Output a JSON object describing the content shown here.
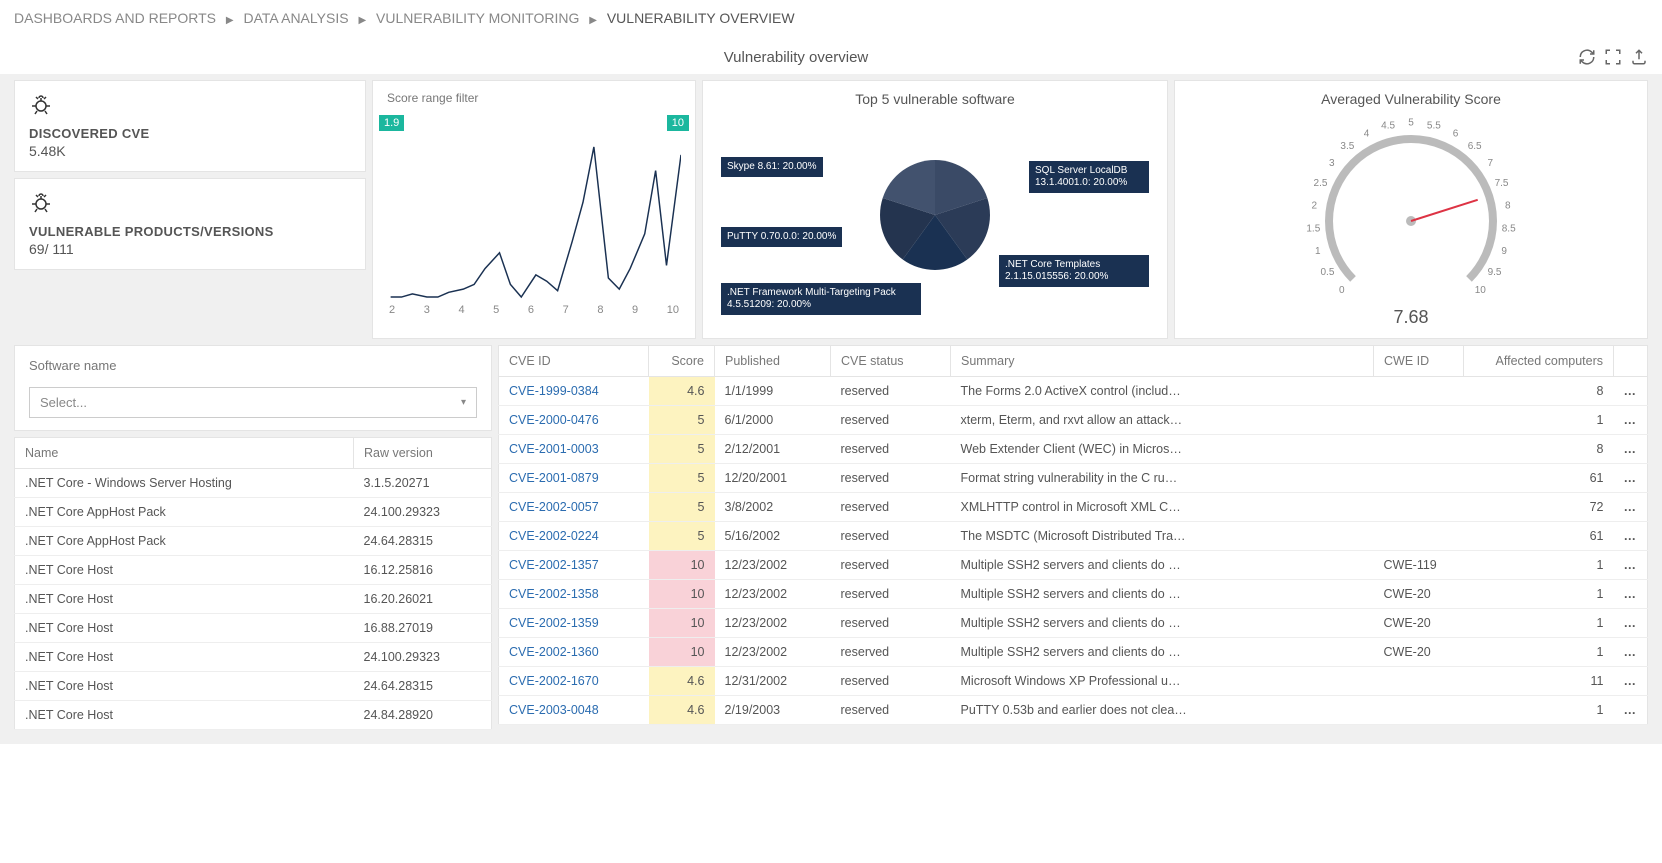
{
  "breadcrumb": {
    "items": [
      "DASHBOARDS AND REPORTS",
      "DATA ANALYSIS",
      "VULNERABILITY MONITORING"
    ],
    "current": "VULNERABILITY OVERVIEW"
  },
  "page_title": "Vulnerability overview",
  "stats": {
    "discovered_cve": {
      "label": "DISCOVERED CVE",
      "value": "5.48K"
    },
    "vulnerable_versions": {
      "label": "VULNERABLE PRODUCTS/VERSIONS",
      "value": "69/ 111"
    }
  },
  "score_filter": {
    "title": "Score range filter",
    "min": "1.9",
    "max": "10",
    "ticks": [
      "2",
      "3",
      "4",
      "5",
      "6",
      "7",
      "8",
      "9",
      "10"
    ]
  },
  "top5": {
    "title": "Top 5 vulnerable software",
    "slices": [
      {
        "label": "Skype 8.61: 20.00%",
        "value": 20
      },
      {
        "label": "SQL Server LocalDB 13.1.4001.0: 20.00%",
        "value": 20
      },
      {
        "label": "PuTTY 0.70.0.0: 20.00%",
        "value": 20
      },
      {
        "label": ".NET Core Templates 2.1.15.015556: 20.00%",
        "value": 20
      },
      {
        "label": ".NET Framework Multi-Targeting Pack 4.5.51209: 20.00%",
        "value": 20
      }
    ]
  },
  "gauge": {
    "title": "Averaged Vulnerability Score",
    "value": "7.68",
    "min": 0,
    "max": 10,
    "ticks": [
      "0",
      "0.5",
      "1",
      "1.5",
      "2",
      "2.5",
      "3",
      "3.5",
      "4",
      "4.5",
      "5",
      "5.5",
      "6",
      "6.5",
      "7",
      "7.5",
      "8",
      "8.5",
      "9",
      "9.5",
      "10"
    ]
  },
  "filter": {
    "label": "Software name",
    "placeholder": "Select..."
  },
  "sw_table": {
    "headers": [
      "Name",
      "Raw version"
    ],
    "rows": [
      {
        "name": ".NET Core - Windows Server Hosting",
        "ver": "3.1.5.20271"
      },
      {
        "name": ".NET Core AppHost Pack",
        "ver": "24.100.29323"
      },
      {
        "name": ".NET Core AppHost Pack",
        "ver": "24.64.28315"
      },
      {
        "name": ".NET Core Host",
        "ver": "16.12.25816"
      },
      {
        "name": ".NET Core Host",
        "ver": "16.20.26021"
      },
      {
        "name": ".NET Core Host",
        "ver": "16.88.27019"
      },
      {
        "name": ".NET Core Host",
        "ver": "24.100.29323"
      },
      {
        "name": ".NET Core Host",
        "ver": "24.64.28315"
      },
      {
        "name": ".NET Core Host",
        "ver": "24.84.28920"
      }
    ]
  },
  "cve_table": {
    "headers": [
      "CVE ID",
      "Score",
      "Published",
      "CVE status",
      "Summary",
      "CWE ID",
      "Affected computers",
      ""
    ],
    "rows": [
      {
        "id": "CVE-1999-0384",
        "score": 4.6,
        "pub": "1/1/1999",
        "status": "reserved",
        "summary": "The Forms 2.0 ActiveX control (includ…",
        "cwe": "",
        "aff": 8
      },
      {
        "id": "CVE-2000-0476",
        "score": 5,
        "pub": "6/1/2000",
        "status": "reserved",
        "summary": "xterm, Eterm, and rxvt allow an attack…",
        "cwe": "",
        "aff": 1
      },
      {
        "id": "CVE-2001-0003",
        "score": 5,
        "pub": "2/12/2001",
        "status": "reserved",
        "summary": "Web Extender Client (WEC) in Micros…",
        "cwe": "",
        "aff": 8
      },
      {
        "id": "CVE-2001-0879",
        "score": 5,
        "pub": "12/20/2001",
        "status": "reserved",
        "summary": "Format string vulnerability in the C ru…",
        "cwe": "",
        "aff": 61
      },
      {
        "id": "CVE-2002-0057",
        "score": 5,
        "pub": "3/8/2002",
        "status": "reserved",
        "summary": "XMLHTTP control in Microsoft XML C…",
        "cwe": "",
        "aff": 72
      },
      {
        "id": "CVE-2002-0224",
        "score": 5,
        "pub": "5/16/2002",
        "status": "reserved",
        "summary": "The MSDTC (Microsoft Distributed Tra…",
        "cwe": "",
        "aff": 61
      },
      {
        "id": "CVE-2002-1357",
        "score": 10,
        "pub": "12/23/2002",
        "status": "reserved",
        "summary": "Multiple SSH2 servers and clients do …",
        "cwe": "CWE-119",
        "aff": 1
      },
      {
        "id": "CVE-2002-1358",
        "score": 10,
        "pub": "12/23/2002",
        "status": "reserved",
        "summary": "Multiple SSH2 servers and clients do …",
        "cwe": "CWE-20",
        "aff": 1
      },
      {
        "id": "CVE-2002-1359",
        "score": 10,
        "pub": "12/23/2002",
        "status": "reserved",
        "summary": "Multiple SSH2 servers and clients do …",
        "cwe": "CWE-20",
        "aff": 1
      },
      {
        "id": "CVE-2002-1360",
        "score": 10,
        "pub": "12/23/2002",
        "status": "reserved",
        "summary": "Multiple SSH2 servers and clients do …",
        "cwe": "CWE-20",
        "aff": 1
      },
      {
        "id": "CVE-2002-1670",
        "score": 4.6,
        "pub": "12/31/2002",
        "status": "reserved",
        "summary": "Microsoft Windows XP Professional u…",
        "cwe": "",
        "aff": 11
      },
      {
        "id": "CVE-2003-0048",
        "score": 4.6,
        "pub": "2/19/2003",
        "status": "reserved",
        "summary": "PuTTY 0.53b and earlier does not clea…",
        "cwe": "",
        "aff": 1
      }
    ]
  },
  "chart_data": [
    {
      "type": "line",
      "name": "score_range_filter",
      "title": "Score range filter",
      "xlabel": "",
      "ylabel": "",
      "x": [
        2.0,
        2.3,
        2.6,
        3.0,
        3.3,
        3.6,
        4.0,
        4.3,
        4.6,
        5.0,
        5.3,
        5.6,
        6.0,
        6.3,
        6.6,
        7.0,
        7.3,
        7.6,
        8.0,
        8.3,
        8.6,
        9.0,
        9.3,
        9.6,
        10.0
      ],
      "values": [
        0,
        0,
        2,
        0,
        0,
        3,
        5,
        8,
        18,
        28,
        8,
        0,
        14,
        10,
        4,
        35,
        60,
        95,
        12,
        5,
        18,
        40,
        80,
        20,
        90
      ],
      "xlim": [
        1.9,
        10
      ]
    },
    {
      "type": "pie",
      "name": "top5_vulnerable_software",
      "title": "Top 5 vulnerable software",
      "categories": [
        "Skype 8.61",
        "SQL Server LocalDB 13.1.4001.0",
        "PuTTY 0.70.0.0",
        ".NET Core Templates 2.1.15.015556",
        ".NET Framework Multi-Targeting Pack 4.5.51209"
      ],
      "values": [
        20,
        20,
        20,
        20,
        20
      ]
    }
  ]
}
